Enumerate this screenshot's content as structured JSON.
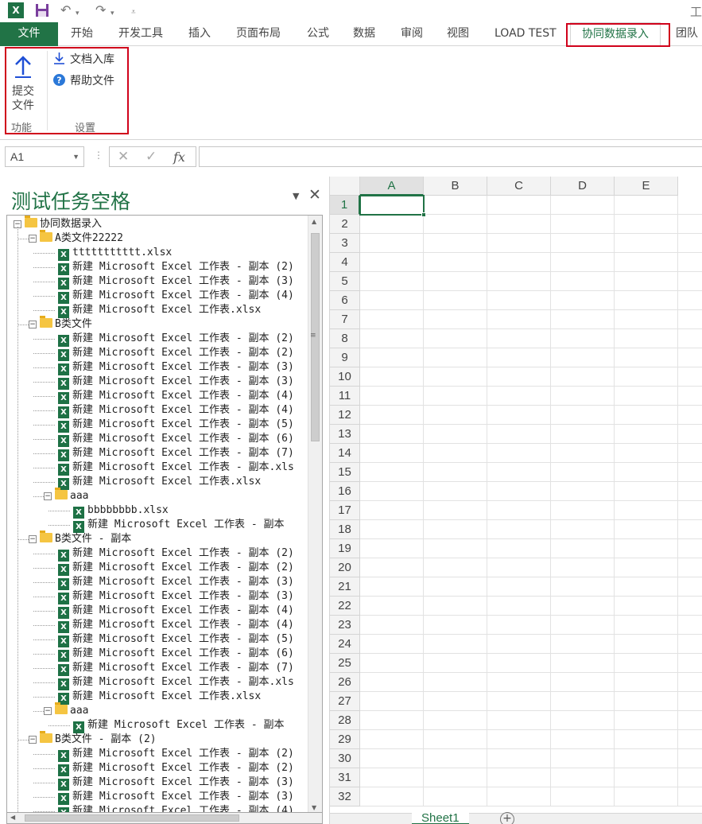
{
  "app": {
    "logo_text": "X",
    "window_title_partial": "工"
  },
  "tabs": [
    {
      "label": "文件"
    },
    {
      "label": "开始"
    },
    {
      "label": "开发工具"
    },
    {
      "label": "插入"
    },
    {
      "label": "页面布局"
    },
    {
      "label": "公式"
    },
    {
      "label": "数据"
    },
    {
      "label": "审阅"
    },
    {
      "label": "视图"
    },
    {
      "label": "LOAD TEST"
    },
    {
      "label": "协同数据录入"
    },
    {
      "label": "团队"
    }
  ],
  "ribbon": {
    "submit_label_line1": "提交",
    "submit_label_line2": "文件",
    "doc_import_label": "文档入库",
    "help_label": "帮助文件",
    "group_function": "功能",
    "group_settings": "设置"
  },
  "formula_bar": {
    "name_box": "A1",
    "fx": "fx",
    "cancel": "✕",
    "enter": "✓"
  },
  "task_pane": {
    "title": "测试任务空格",
    "root": "协同数据录入",
    "nodes": [
      {
        "t": "A类文件22222",
        "lvl": 1,
        "type": "folder"
      },
      {
        "t": "ttttttttttt.xlsx",
        "lvl": 2,
        "type": "file"
      },
      {
        "t": "新建 Microsoft Excel 工作表 - 副本 (2)",
        "lvl": 2,
        "type": "file"
      },
      {
        "t": "新建 Microsoft Excel 工作表 - 副本 (3)",
        "lvl": 2,
        "type": "file"
      },
      {
        "t": "新建 Microsoft Excel 工作表 - 副本 (4)",
        "lvl": 2,
        "type": "file"
      },
      {
        "t": "新建 Microsoft Excel 工作表.xlsx",
        "lvl": 2,
        "type": "file"
      },
      {
        "t": "B类文件",
        "lvl": 1,
        "type": "folder"
      },
      {
        "t": "新建 Microsoft Excel 工作表 - 副本 (2)",
        "lvl": 2,
        "type": "file"
      },
      {
        "t": "新建 Microsoft Excel 工作表 - 副本 (2)",
        "lvl": 2,
        "type": "file"
      },
      {
        "t": "新建 Microsoft Excel 工作表 - 副本 (3)",
        "lvl": 2,
        "type": "file"
      },
      {
        "t": "新建 Microsoft Excel 工作表 - 副本 (3)",
        "lvl": 2,
        "type": "file"
      },
      {
        "t": "新建 Microsoft Excel 工作表 - 副本 (4)",
        "lvl": 2,
        "type": "file"
      },
      {
        "t": "新建 Microsoft Excel 工作表 - 副本 (4)",
        "lvl": 2,
        "type": "file"
      },
      {
        "t": "新建 Microsoft Excel 工作表 - 副本 (5)",
        "lvl": 2,
        "type": "file"
      },
      {
        "t": "新建 Microsoft Excel 工作表 - 副本 (6)",
        "lvl": 2,
        "type": "file"
      },
      {
        "t": "新建 Microsoft Excel 工作表 - 副本 (7)",
        "lvl": 2,
        "type": "file"
      },
      {
        "t": "新建 Microsoft Excel 工作表 - 副本.xls",
        "lvl": 2,
        "type": "file"
      },
      {
        "t": "新建 Microsoft Excel 工作表.xlsx",
        "lvl": 2,
        "type": "file"
      },
      {
        "t": "aaa",
        "lvl": 2,
        "type": "folder"
      },
      {
        "t": "bbbbbbbb.xlsx",
        "lvl": 3,
        "type": "file"
      },
      {
        "t": "新建 Microsoft Excel 工作表 - 副本",
        "lvl": 3,
        "type": "file"
      },
      {
        "t": "B类文件 - 副本",
        "lvl": 1,
        "type": "folder"
      },
      {
        "t": "新建 Microsoft Excel 工作表 - 副本 (2)",
        "lvl": 2,
        "type": "file"
      },
      {
        "t": "新建 Microsoft Excel 工作表 - 副本 (2)",
        "lvl": 2,
        "type": "file"
      },
      {
        "t": "新建 Microsoft Excel 工作表 - 副本 (3)",
        "lvl": 2,
        "type": "file"
      },
      {
        "t": "新建 Microsoft Excel 工作表 - 副本 (3)",
        "lvl": 2,
        "type": "file"
      },
      {
        "t": "新建 Microsoft Excel 工作表 - 副本 (4)",
        "lvl": 2,
        "type": "file"
      },
      {
        "t": "新建 Microsoft Excel 工作表 - 副本 (4)",
        "lvl": 2,
        "type": "file"
      },
      {
        "t": "新建 Microsoft Excel 工作表 - 副本 (5)",
        "lvl": 2,
        "type": "file"
      },
      {
        "t": "新建 Microsoft Excel 工作表 - 副本 (6)",
        "lvl": 2,
        "type": "file"
      },
      {
        "t": "新建 Microsoft Excel 工作表 - 副本 (7)",
        "lvl": 2,
        "type": "file"
      },
      {
        "t": "新建 Microsoft Excel 工作表 - 副本.xls",
        "lvl": 2,
        "type": "file"
      },
      {
        "t": "新建 Microsoft Excel 工作表.xlsx",
        "lvl": 2,
        "type": "file"
      },
      {
        "t": "aaa",
        "lvl": 2,
        "type": "folder"
      },
      {
        "t": "新建 Microsoft Excel 工作表 - 副本",
        "lvl": 3,
        "type": "file"
      },
      {
        "t": "B类文件 - 副本 (2)",
        "lvl": 1,
        "type": "folder"
      },
      {
        "t": "新建 Microsoft Excel 工作表 - 副本 (2)",
        "lvl": 2,
        "type": "file"
      },
      {
        "t": "新建 Microsoft Excel 工作表 - 副本 (2)",
        "lvl": 2,
        "type": "file"
      },
      {
        "t": "新建 Microsoft Excel 工作表 - 副本 (3)",
        "lvl": 2,
        "type": "file"
      },
      {
        "t": "新建 Microsoft Excel 工作表 - 副本 (3)",
        "lvl": 2,
        "type": "file"
      },
      {
        "t": "新建 Microsoft Excel 工作表 - 副本 (4)",
        "lvl": 2,
        "type": "file"
      }
    ]
  },
  "sheet": {
    "columns": [
      "A",
      "B",
      "C",
      "D",
      "E"
    ],
    "rows": [
      "1",
      "2",
      "3",
      "4",
      "5",
      "6",
      "7",
      "8",
      "9",
      "10",
      "11",
      "12",
      "13",
      "14",
      "15",
      "16",
      "17",
      "18",
      "19",
      "20",
      "21",
      "22",
      "23",
      "24",
      "25",
      "26",
      "27",
      "28",
      "29",
      "30",
      "31",
      "32"
    ],
    "active_cell": "A1",
    "sheet_tab": "Sheet1",
    "add_sheet": "+"
  },
  "colors": {
    "excel_green": "#217346",
    "highlight_red": "#d0021b"
  }
}
